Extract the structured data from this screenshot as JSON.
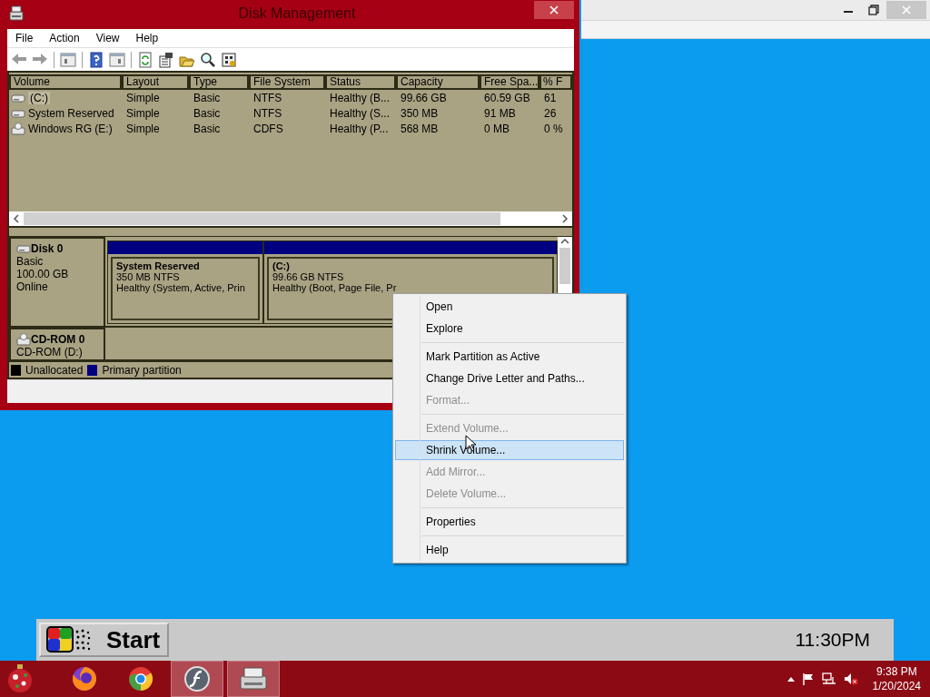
{
  "window": {
    "title": "Disk Management"
  },
  "menu_bar": [
    "File",
    "Action",
    "View",
    "Help"
  ],
  "volumes": {
    "columns": [
      "Volume",
      "Layout",
      "Type",
      "File System",
      "Status",
      "Capacity",
      "Free Spa...",
      "% F"
    ],
    "rows": [
      {
        "kind": "disk",
        "selected": true,
        "cells": [
          "(C:)",
          "Simple",
          "Basic",
          "NTFS",
          "Healthy (B...",
          "99.66 GB",
          "60.59 GB",
          "61"
        ]
      },
      {
        "kind": "disk",
        "selected": false,
        "cells": [
          "System Reserved",
          "Simple",
          "Basic",
          "NTFS",
          "Healthy (S...",
          "350 MB",
          "91 MB",
          "26"
        ]
      },
      {
        "kind": "cdrom",
        "selected": false,
        "cells": [
          "Windows RG (E:)",
          "Simple",
          "Basic",
          "CDFS",
          "Healthy (P...",
          "568 MB",
          "0 MB",
          "0 %"
        ]
      }
    ]
  },
  "disks": [
    {
      "kind": "disk",
      "name": "Disk 0",
      "lines": [
        "Basic",
        "100.00 GB",
        "Online"
      ],
      "partitions": [
        {
          "name": "System Reserved",
          "size": "350 MB NTFS",
          "status": "Healthy (System, Active, Prin"
        },
        {
          "name": "(C:)",
          "size": "99.66 GB NTFS",
          "status": "Healthy (Boot, Page File, Pr"
        }
      ]
    },
    {
      "kind": "cdrom",
      "name": "CD-ROM 0",
      "lines": [
        "CD-ROM (D:)"
      ]
    }
  ],
  "legend": [
    {
      "label": "Unallocated",
      "color": "#000000"
    },
    {
      "label": "Primary partition",
      "color": "#000080"
    }
  ],
  "context_menu": {
    "groups": [
      {
        "items": [
          {
            "label": "Open",
            "disabled": false,
            "selected": false
          },
          {
            "label": "Explore",
            "disabled": false,
            "selected": false
          }
        ]
      },
      {
        "items": [
          {
            "label": "Mark Partition as Active",
            "disabled": false,
            "selected": false
          },
          {
            "label": "Change Drive Letter and Paths...",
            "disabled": false,
            "selected": false
          },
          {
            "label": "Format...",
            "disabled": true,
            "selected": false
          }
        ]
      },
      {
        "items": [
          {
            "label": "Extend Volume...",
            "disabled": true,
            "selected": false
          },
          {
            "label": "Shrink Volume...",
            "disabled": false,
            "selected": true
          },
          {
            "label": "Add Mirror...",
            "disabled": true,
            "selected": false
          },
          {
            "label": "Delete Volume...",
            "disabled": true,
            "selected": false
          }
        ]
      },
      {
        "items": [
          {
            "label": "Properties",
            "disabled": false,
            "selected": false
          }
        ]
      },
      {
        "items": [
          {
            "label": "Help",
            "disabled": false,
            "selected": false
          }
        ]
      }
    ]
  },
  "start_bar": {
    "label": "Start",
    "clock": "11:30PM"
  },
  "taskbar": {
    "apps": [
      {
        "kind": "fox",
        "active": false
      },
      {
        "kind": "chrome",
        "active": false
      },
      {
        "kind": "flash",
        "active": true
      },
      {
        "kind": "drive",
        "active": true
      }
    ],
    "tray": {
      "time": "9:38 PM",
      "date": "1/20/2024"
    }
  }
}
